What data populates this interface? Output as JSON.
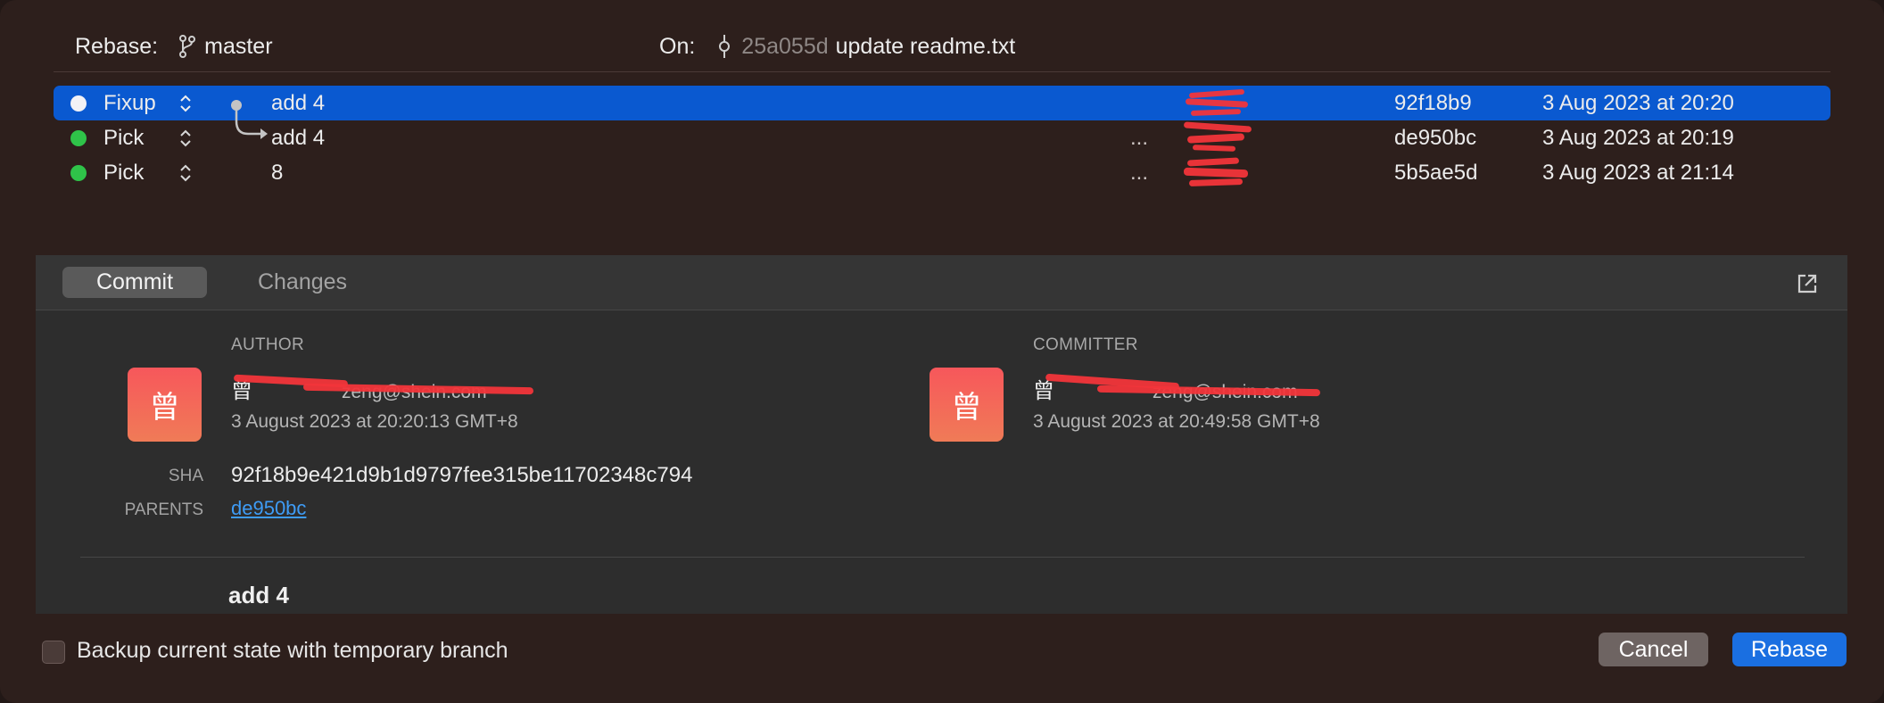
{
  "header": {
    "rebase_label": "Rebase:",
    "branch": "master",
    "on_label": "On:",
    "on_sha": "25a055d",
    "on_message": "update readme.txt"
  },
  "commits": [
    {
      "action": "Fixup",
      "message": "add 4",
      "ellipsis": "",
      "sha": "92f18b9",
      "date": "3 Aug 2023 at 20:20",
      "selected": true
    },
    {
      "action": "Pick",
      "message": "add 4",
      "ellipsis": "...",
      "sha": "de950bc",
      "date": "3 Aug 2023 at 20:19",
      "selected": false
    },
    {
      "action": "Pick",
      "message": "8",
      "ellipsis": "...",
      "sha": "5b5ae5d",
      "date": "3 Aug 2023 at 21:14",
      "selected": false
    }
  ],
  "tabs": {
    "commit": "Commit",
    "changes": "Changes"
  },
  "details": {
    "author_label": "AUTHOR",
    "committer_label": "COMMITTER",
    "author": {
      "avatar": "曾",
      "name": "曾",
      "email": "zeng@shein.com",
      "date": "3 August 2023 at 20:20:13 GMT+8"
    },
    "committer": {
      "avatar": "曾",
      "name": "曾",
      "email": "zeng@shein.com",
      "date": "3 August 2023 at 20:49:58 GMT+8"
    },
    "sha_label": "SHA",
    "sha": "92f18b9e421d9b1d9797fee315be11702348c794",
    "parents_label": "PARENTS",
    "parent": "de950bc",
    "subject": "add 4"
  },
  "footer": {
    "backup_label": "Backup current state with temporary branch",
    "cancel": "Cancel",
    "rebase": "Rebase"
  },
  "colors": {
    "selection": "#0a59d0",
    "pick_dot": "#2fc349",
    "primary_button": "#1a6fe1",
    "redaction": "#f2353a"
  }
}
